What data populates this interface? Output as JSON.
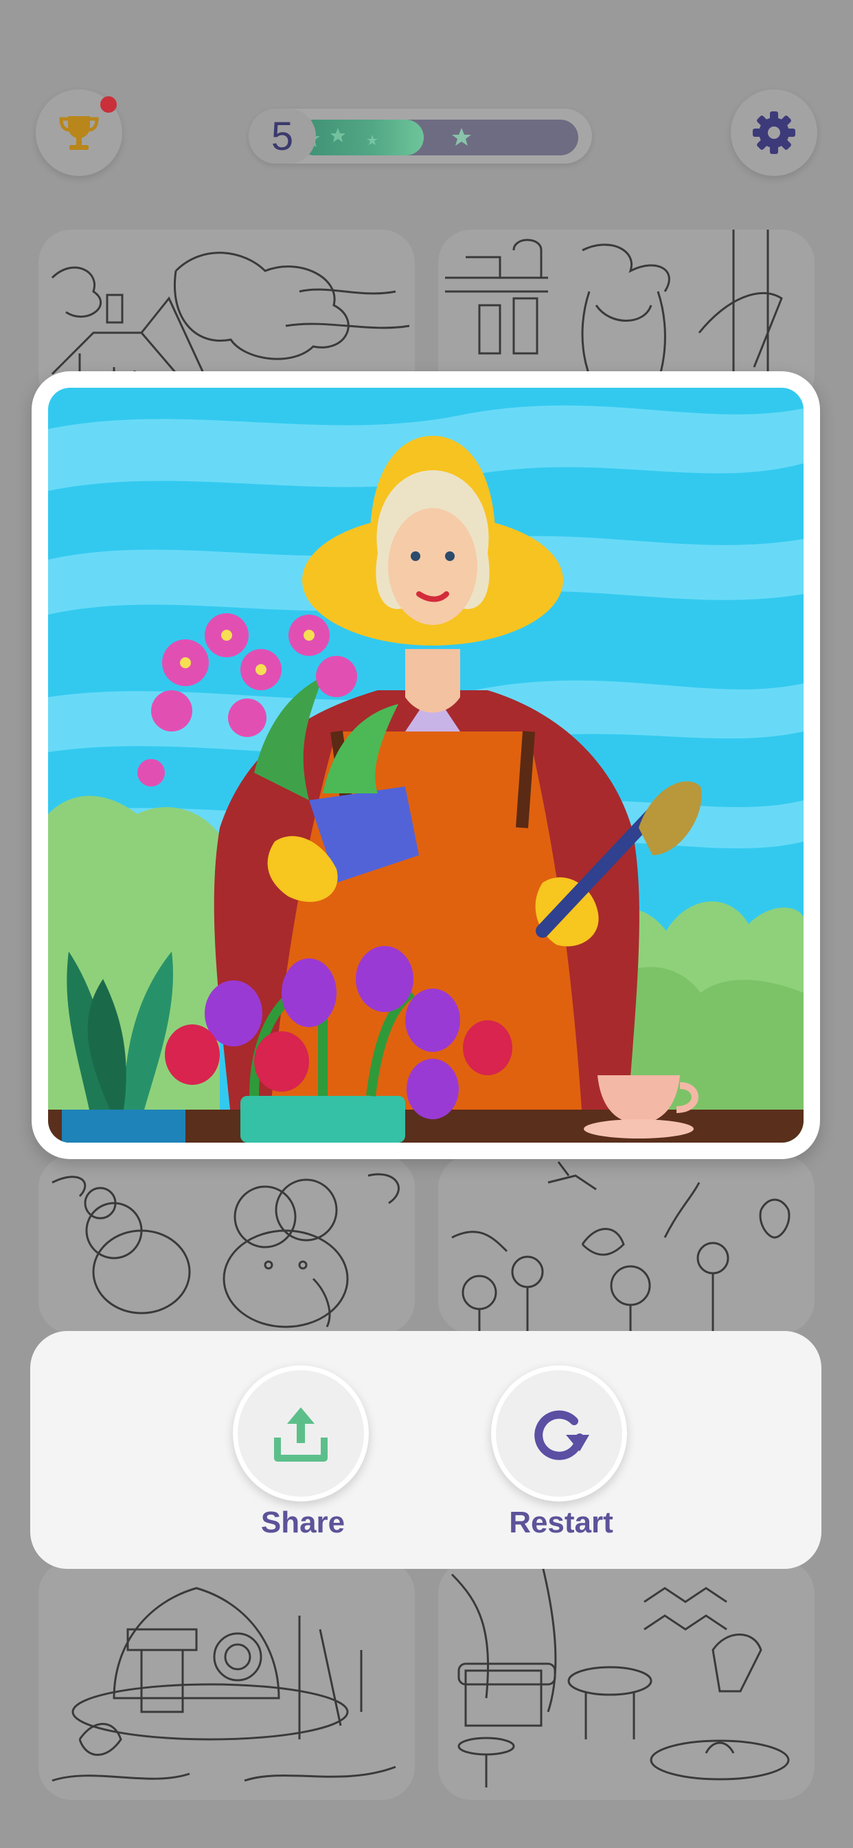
{
  "header": {
    "trophy_icon": "trophy-icon",
    "notification_dot_color": "#c9303a",
    "level": "5",
    "level_progress": 0.45,
    "settings_icon": "gear-icon"
  },
  "featured_image": {
    "subject": "woman-gardener-with-orchid-and-tulips",
    "state": "completed"
  },
  "gallery": {
    "tiles": [
      "house-drawing",
      "girl-with-bow-drawing",
      "mice-drawing",
      "flowers-and-bird-drawing",
      "fairy-house-drawing",
      "cozy-room-drawing"
    ]
  },
  "actions": {
    "share_label": "Share",
    "restart_label": "Restart",
    "share_icon": "share-icon",
    "restart_icon": "restart-icon",
    "share_color": "#5cbf8a",
    "restart_color": "#5a4fa3"
  }
}
